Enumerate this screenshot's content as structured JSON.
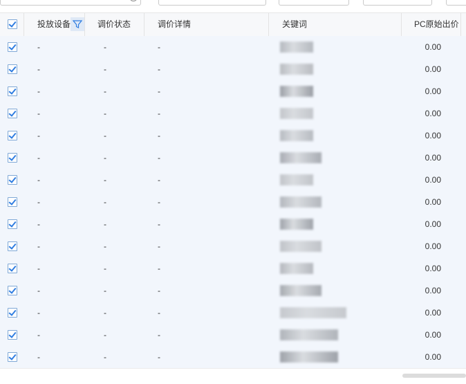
{
  "table": {
    "columns": [
      {
        "key": "device",
        "label": "投放设备"
      },
      {
        "key": "status",
        "label": "调价状态"
      },
      {
        "key": "detail",
        "label": "调价详情"
      },
      {
        "key": "keyword",
        "label": "关键词"
      },
      {
        "key": "pc_bid",
        "label": "PC原始出价"
      }
    ],
    "rows": [
      {
        "device": "-",
        "status": "-",
        "detail": "-",
        "pc_bid": "0.00",
        "checked": true
      },
      {
        "device": "-",
        "status": "-",
        "detail": "-",
        "pc_bid": "0.00",
        "checked": true
      },
      {
        "device": "-",
        "status": "-",
        "detail": "-",
        "pc_bid": "0.00",
        "checked": true
      },
      {
        "device": "-",
        "status": "-",
        "detail": "-",
        "pc_bid": "0.00",
        "checked": true
      },
      {
        "device": "-",
        "status": "-",
        "detail": "-",
        "pc_bid": "0.00",
        "checked": true
      },
      {
        "device": "-",
        "status": "-",
        "detail": "-",
        "pc_bid": "0.00",
        "checked": true
      },
      {
        "device": "-",
        "status": "-",
        "detail": "-",
        "pc_bid": "0.00",
        "checked": true
      },
      {
        "device": "-",
        "status": "-",
        "detail": "-",
        "pc_bid": "0.00",
        "checked": true
      },
      {
        "device": "-",
        "status": "-",
        "detail": "-",
        "pc_bid": "0.00",
        "checked": true
      },
      {
        "device": "-",
        "status": "-",
        "detail": "-",
        "pc_bid": "0.00",
        "checked": true
      },
      {
        "device": "-",
        "status": "-",
        "detail": "-",
        "pc_bid": "0.00",
        "checked": true
      },
      {
        "device": "-",
        "status": "-",
        "detail": "-",
        "pc_bid": "0.00",
        "checked": true
      },
      {
        "device": "-",
        "status": "-",
        "detail": "-",
        "pc_bid": "0.00",
        "checked": true
      },
      {
        "device": "-",
        "status": "-",
        "detail": "-",
        "pc_bid": "0.00",
        "checked": true
      },
      {
        "device": "-",
        "status": "-",
        "detail": "-",
        "pc_bid": "0.00",
        "checked": true
      }
    ],
    "select_all_checked": true
  },
  "colors": {
    "accent": "#2f7de1",
    "row_background": "#f2f6fc",
    "header_background": "#f7f8fa"
  },
  "icons": {
    "filter": "filter-icon",
    "checkbox": "checkbox-checked-icon"
  }
}
